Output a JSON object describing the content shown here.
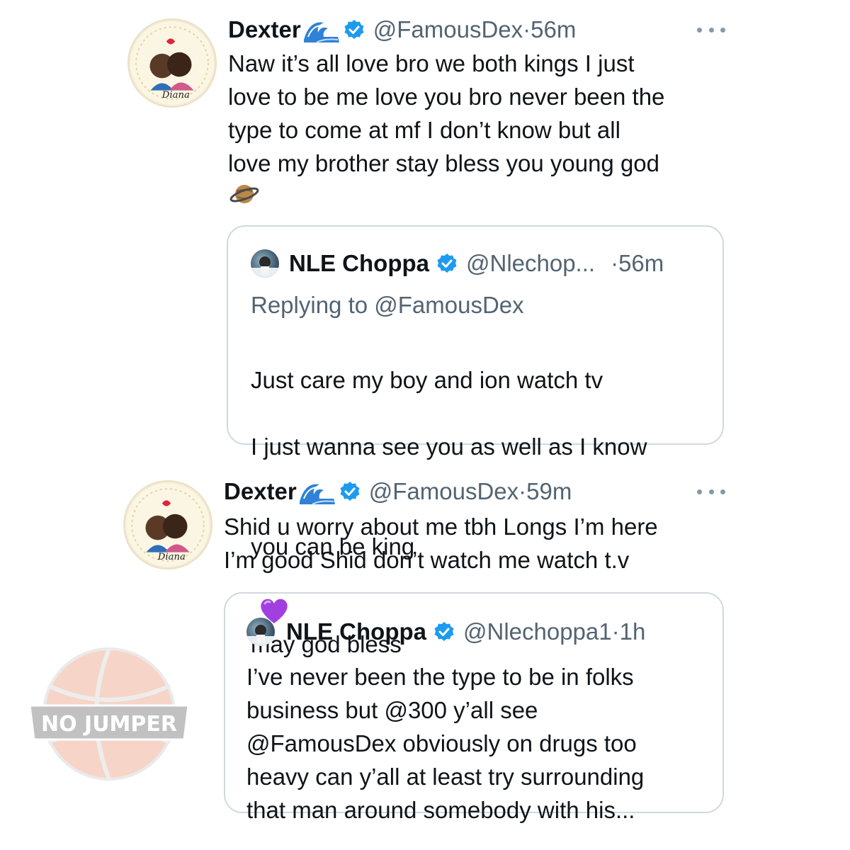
{
  "tweets": [
    {
      "name": "Dexter",
      "handle": "@FamousDex",
      "dot": "·",
      "time": "56m",
      "name_emoji": "wave-emoji",
      "text": "Naw it’s all love bro we both kings I just\nlove to be me love you bro never been the\ntype to come at mf I don’t know but all\nlove my brother stay bless you young god",
      "trailing_emoji": "ringed-planet-emoji",
      "quote": {
        "name": "NLE Choppa",
        "handle": "@Nlechop...",
        "dot": "·",
        "time": "56m",
        "replying_prefix": "Replying to ",
        "replying_to": "@FamousDex",
        "text_line1": "Just care my boy and ion watch tv",
        "text_line2": "I just wanna see you as well as I know",
        "text_line3a": "you can be king",
        "text_line3b": "may god bless",
        "emoji": "purple-heart-emoji"
      }
    },
    {
      "name": "Dexter",
      "handle": "@FamousDex",
      "dot": "·",
      "time": "59m",
      "name_emoji": "wave-emoji",
      "text": "Shid u worry about me tbh Longs I’m here\nI’m good Shid don’t watch me watch t.v",
      "quote": {
        "name": "NLE Choppa",
        "handle": "@Nlechoppa1",
        "dot": "·",
        "time": "1h",
        "text": "I’ve never been the type to be in folks\nbusiness but @300 y’all see\n@FamousDex obviously on drugs too\nheavy can y’all at least try surrounding\nthat man around somebody with his..."
      }
    }
  ],
  "watermark": {
    "text": "NO JUMPER"
  },
  "colors": {
    "verified": "#1d9bf0",
    "secondary_text": "#536471",
    "border": "#cfd9de",
    "purple_heart": "#a23fe0"
  }
}
